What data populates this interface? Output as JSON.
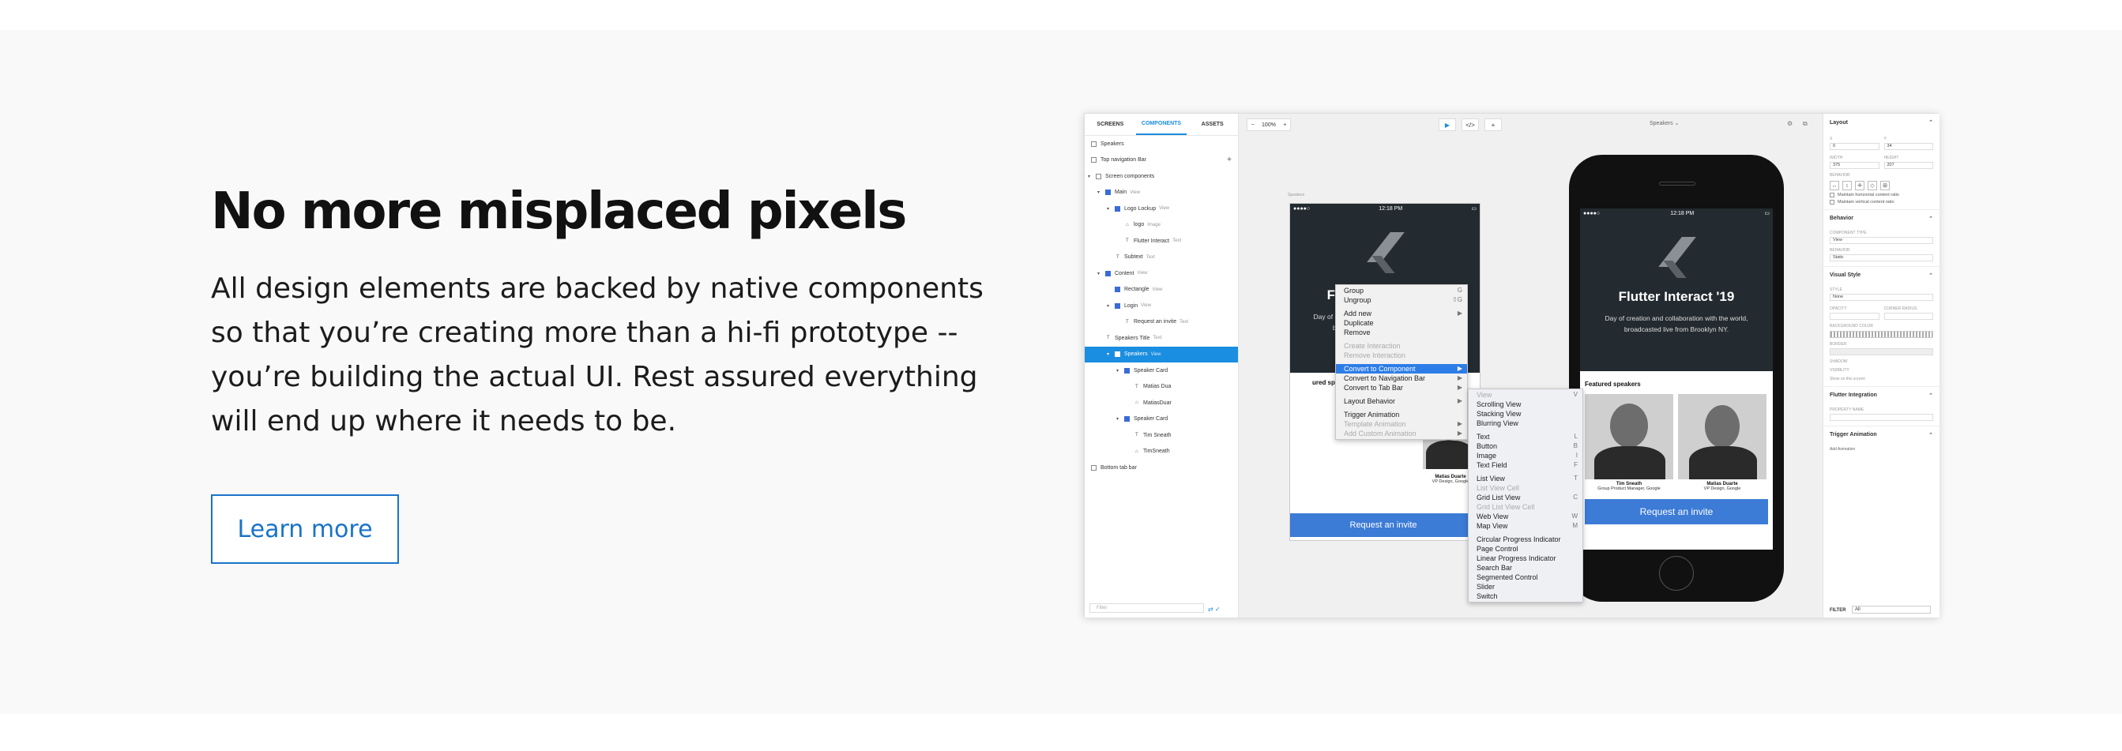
{
  "hero": {
    "headline": "No more misplaced pixels",
    "body": "All design elements are backed by native components so that you’re creating more than a hi-fi prototype -- you’re building the actual UI. Rest assured everything will end up where it needs to be.",
    "cta": "Learn more"
  },
  "app": {
    "left_tabs": [
      "SCREENS",
      "COMPONENTS",
      "ASSETS"
    ],
    "tree": [
      {
        "label": "Speakers",
        "tag": ""
      },
      {
        "label": "Top navigation Bar",
        "tag": ""
      },
      {
        "label": "Screen components",
        "tag": ""
      },
      {
        "label": "Main",
        "tag": "View"
      },
      {
        "label": "Logo Lockup",
        "tag": "View"
      },
      {
        "label": "logo",
        "tag": "Image"
      },
      {
        "label": "Flutter Interact",
        "tag": "Text"
      },
      {
        "label": "Subtext",
        "tag": "Text"
      },
      {
        "label": "Content",
        "tag": "View"
      },
      {
        "label": "Rectangle",
        "tag": "View"
      },
      {
        "label": "Login",
        "tag": "View"
      },
      {
        "label": "Request an invite",
        "tag": "Text"
      },
      {
        "label": "Speakers Title",
        "tag": "Text"
      },
      {
        "label": "Speakers",
        "tag": "View"
      },
      {
        "label": "Speaker Card",
        "tag": ""
      },
      {
        "label": "Matias Dua",
        "tag": ""
      },
      {
        "label": "MatiasDuar",
        "tag": ""
      },
      {
        "label": "Speaker Card",
        "tag": ""
      },
      {
        "label": "Tim Sneath",
        "tag": ""
      },
      {
        "label": "TimSneath",
        "tag": ""
      },
      {
        "label": "Bottom tab bar",
        "tag": ""
      }
    ],
    "filter_placeholder": "Filter",
    "zoom": "100%",
    "screen_select": "Speakers ⌄",
    "artboard_label": "Speakers",
    "mock": {
      "time": "12:18 PM",
      "signal": "●●●●○",
      "title": "Flutter Interact '19",
      "desc": "Day of creation and collaboration with the world, broadcasted live from Brooklyn NY.",
      "featured": "Featured speakers",
      "featured_partial": "ured speakers",
      "speaker1_name": "Tim Sneath",
      "speaker1_role": "Group Product Manager, Google",
      "speaker2_name": "Matias Duarte",
      "speaker2_role": "VP Design, Google",
      "cta": "Request an invite"
    },
    "context_menu": [
      {
        "label": "Group",
        "shortcut": "G",
        "state": ""
      },
      {
        "label": "Ungroup",
        "shortcut": "⇧G",
        "state": ""
      },
      {
        "sep": true
      },
      {
        "label": "Add new",
        "shortcut": "▶",
        "state": ""
      },
      {
        "label": "Duplicate",
        "shortcut": "",
        "state": ""
      },
      {
        "label": "Remove",
        "shortcut": "",
        "state": ""
      },
      {
        "sep": true
      },
      {
        "label": "Create Interaction",
        "shortcut": "",
        "state": "dis"
      },
      {
        "label": "Remove Interaction",
        "shortcut": "",
        "state": "dis"
      },
      {
        "sep": true
      },
      {
        "label": "Convert to Component",
        "shortcut": "▶",
        "state": "hl"
      },
      {
        "label": "Convert to Navigation Bar",
        "shortcut": "▶",
        "state": ""
      },
      {
        "label": "Convert to Tab Bar",
        "shortcut": "▶",
        "state": ""
      },
      {
        "sep": true
      },
      {
        "label": "Layout Behavior",
        "shortcut": "▶",
        "state": ""
      },
      {
        "sep": true
      },
      {
        "label": "Trigger Animation",
        "shortcut": "",
        "state": ""
      },
      {
        "label": "Template Animation",
        "shortcut": "▶",
        "state": "dis"
      },
      {
        "label": "Add Custom Animation",
        "shortcut": "▶",
        "state": "dis"
      }
    ],
    "submenu": [
      {
        "label": "View",
        "shortcut": "V",
        "state": "dis"
      },
      {
        "label": "Scrolling View",
        "shortcut": "",
        "state": ""
      },
      {
        "label": "Stacking View",
        "shortcut": "",
        "state": ""
      },
      {
        "label": "Blurring View",
        "shortcut": "",
        "state": ""
      },
      {
        "sep": true
      },
      {
        "label": "Text",
        "shortcut": "L",
        "state": ""
      },
      {
        "label": "Button",
        "shortcut": "B",
        "state": ""
      },
      {
        "label": "Image",
        "shortcut": "I",
        "state": ""
      },
      {
        "label": "Text Field",
        "shortcut": "F",
        "state": ""
      },
      {
        "sep": true
      },
      {
        "label": "List View",
        "shortcut": "T",
        "state": ""
      },
      {
        "label": "List View Cell",
        "shortcut": "",
        "state": "dis"
      },
      {
        "label": "Grid List View",
        "shortcut": "C",
        "state": ""
      },
      {
        "label": "Grid List View Cell",
        "shortcut": "",
        "state": "dis"
      },
      {
        "label": "Web View",
        "shortcut": "W",
        "state": ""
      },
      {
        "label": "Map View",
        "shortcut": "M",
        "state": ""
      },
      {
        "sep": true
      },
      {
        "label": "Circular Progress Indicator",
        "shortcut": "",
        "state": ""
      },
      {
        "label": "Page Control",
        "shortcut": "",
        "state": ""
      },
      {
        "label": "Linear Progress Indicator",
        "shortcut": "",
        "state": ""
      },
      {
        "label": "Search Bar",
        "shortcut": "",
        "state": ""
      },
      {
        "label": "Segmented Control",
        "shortcut": "",
        "state": ""
      },
      {
        "label": "Slider",
        "shortcut": "",
        "state": ""
      },
      {
        "label": "Switch",
        "shortcut": "",
        "state": ""
      }
    ],
    "right": {
      "layout": "Layout",
      "x_label": "X",
      "x_val": "0",
      "y_label": "Y",
      "y_val": "34",
      "w_label": "WIDTH",
      "w_val": "375",
      "h_label": "HEIGHT",
      "h_val": "207",
      "behavior_label": "BEHAVIOR",
      "maintain_h": "Maintain horizontal content ratio",
      "maintain_v": "Maintain vertical content ratio",
      "behavior": "Behavior",
      "comp_type_label": "COMPONENT TYPE",
      "comp_type": "View",
      "behavior_sel_label": "BEHAVIOR",
      "behavior_sel": "Static",
      "visual": "Visual Style",
      "style_label": "STYLE",
      "style": "None",
      "opacity_label": "OPACITY",
      "corner_label": "CORNER RADIUS",
      "bg_label": "BACKGROUND COLOR",
      "border_label": "BORDER",
      "shadow_label": "SHADOW",
      "visibility_label": "VISIBILITY",
      "visibility_hint": "Show on this screen",
      "flutter": "Flutter Integration",
      "prop_label": "PROPERTY NAME",
      "trigger": "Trigger Animation",
      "add_anim": "Add Animation",
      "filter_label": "FILTER",
      "filter_val": "All"
    }
  }
}
